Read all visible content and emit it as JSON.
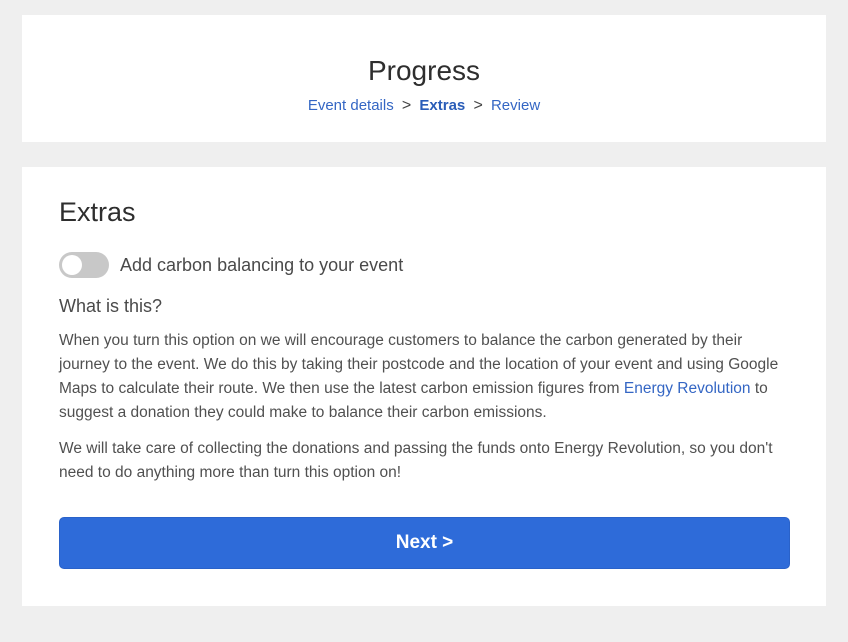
{
  "progress": {
    "title": "Progress",
    "steps": [
      {
        "label": "Event details"
      },
      {
        "label": "Extras"
      },
      {
        "label": "Review"
      }
    ],
    "separator": ">"
  },
  "extras": {
    "heading": "Extras",
    "toggle": {
      "label": "Add carbon balancing to your event",
      "on": false
    },
    "what_is_this": "What is this?",
    "para1_text_a": "When you turn this option on we will encourage customers to balance the carbon generated by their journey to the event. We do this by taking their postcode and the location of your event and using Google Maps to calculate their route. We then use the latest carbon emission figures from ",
    "para1_link": "Energy Revolution",
    "para1_text_b": " to suggest a donation they could make to balance their carbon emissions.",
    "para2": "We will take care of collecting the donations and passing the funds onto Energy Revolution, so you don't need to do anything more than turn this option on!",
    "next_label": "Next >"
  },
  "colors": {
    "accent": "#2e6bd9",
    "link": "#3466c4",
    "background": "#efefef",
    "toggle_off": "#c8c8c8"
  }
}
